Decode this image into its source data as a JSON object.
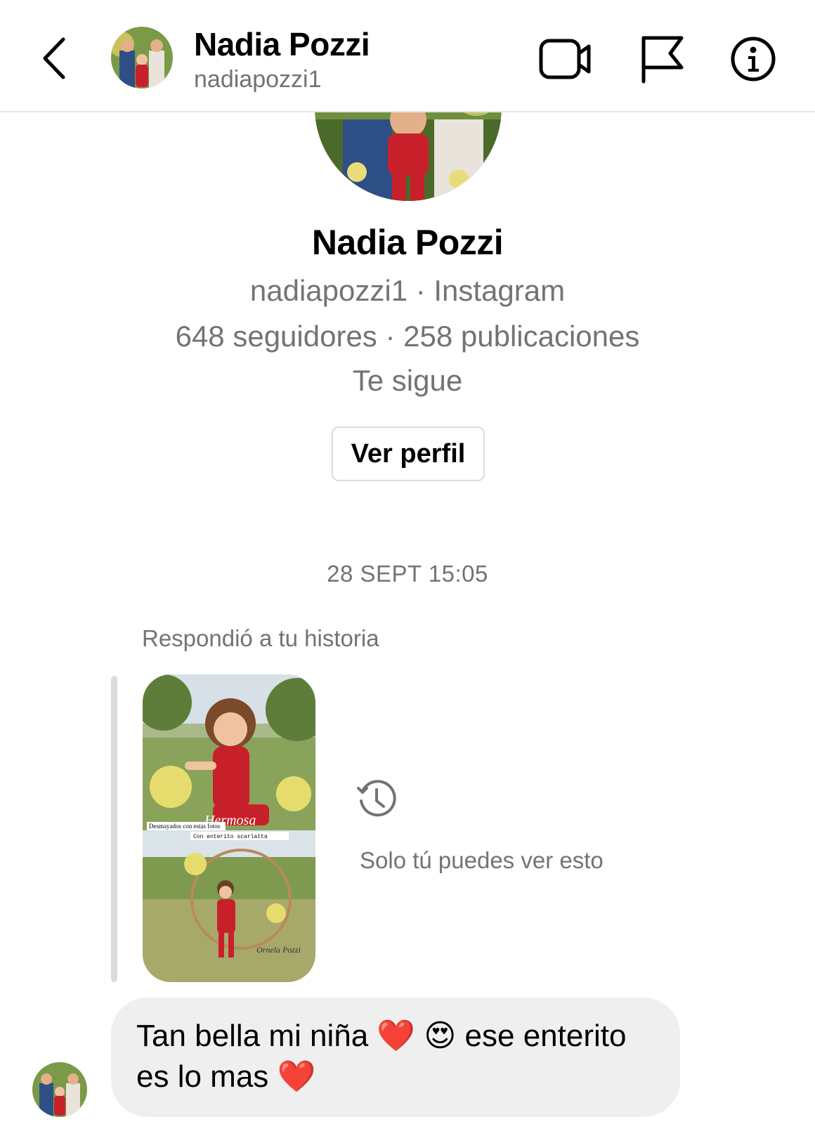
{
  "header": {
    "name": "Nadia Pozzi",
    "username": "nadiapozzi1"
  },
  "profile": {
    "name": "Nadia Pozzi",
    "subtitle": "nadiapozzi1 · Instagram",
    "stats": "648 seguidores · 258 publicaciones",
    "follow_status": "Te sigue",
    "view_profile_label": "Ver perfil"
  },
  "conversation": {
    "timestamp": "28 SEPT 15:05",
    "replied_label": "Respondió a tu historia",
    "story": {
      "caption_title": "Hermosa",
      "caption_line1": "Desmayados con estas fotos",
      "caption_line2": "Con enterito scarlatta",
      "watermark": "Ornela Pozzi"
    },
    "only_you_label": "Solo tú puedes ver esto",
    "message": "Tan bella mi niña ❤️ 😍 ese enterito es lo mas ❤️"
  },
  "icons": {
    "back": "chevron-left-icon",
    "video": "video-call-icon",
    "flag": "flag-icon",
    "info": "info-icon",
    "history": "history-icon"
  },
  "colors": {
    "secondary_text": "#737373",
    "bubble_bg": "#efefef",
    "border": "#dbdbdb"
  }
}
